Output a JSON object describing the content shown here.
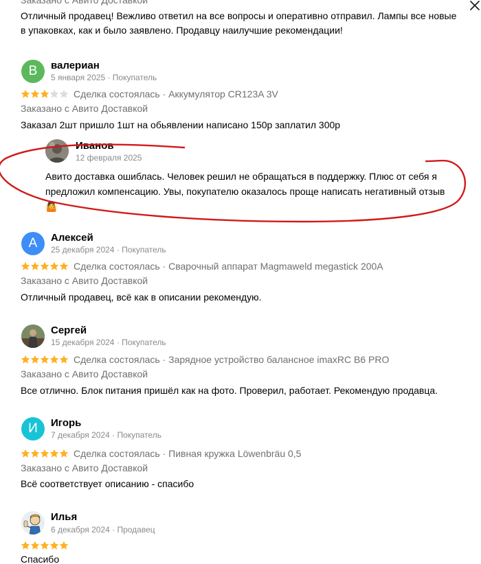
{
  "top": {
    "ordered_label": "Заказано с Авито Доставкой",
    "text_line1": "Отличный продавец! Вежливо ответил на все вопросы и оперативно отправил. Лампы все новые",
    "text_line2": "в упаковках, как и было заявлено. Продавцу наилучшие рекомендации!"
  },
  "reviews": [
    {
      "name": "валериан",
      "initial": "В",
      "avatar_color": "#5cb85c",
      "date_role": "5 января 2025 · Покупатель",
      "rating": 3,
      "deal": "Сделка состоялась · Аккумулятор CR123A 3V",
      "ordered_label": "Заказано с Авито Доставкой",
      "text": "Заказал 2шт пришло 1шт на обьявлении написано 150р заплатил 300р",
      "reply": {
        "name": "Иванов",
        "date": "12 февраля 2025",
        "text_line1": "Авито доставка ошиблась. Человек решил не обращаться в поддержку. Плюс от себя я",
        "text_line2": "предложил компенсацию. Увы, покупателю оказалось проще написать негативный отзыв",
        "emoji": "🤷"
      }
    },
    {
      "name": "Алексей",
      "initial": "А",
      "avatar_color": "#3d8ef7",
      "date_role": "25 декабря 2024 · Покупатель",
      "rating": 5,
      "deal": "Сделка состоялась · Сварочный аппарат Magmaweld megastick 200A",
      "ordered_label": "Заказано с Авито Доставкой",
      "text": "Отличный продавец, всё как в описании рекомендую."
    },
    {
      "name": "Сергей",
      "date_role": "15 декабря 2024 · Покупатель",
      "rating": 5,
      "deal": "Сделка состоялась · Зарядное устройство балансное imaxRC B6 PRO",
      "ordered_label": "Заказано с Авито Доставкой",
      "text": "Все отлично. Блок питания пришёл как на фото. Проверил, работает. Рекомендую продавца."
    },
    {
      "name": "Игорь",
      "initial": "И",
      "avatar_color": "#19c3d6",
      "date_role": "7 декабря 2024 · Покупатель",
      "rating": 5,
      "deal": "Сделка состоялась · Пивная кружка Löwenbräu 0,5",
      "ordered_label": "Заказано с Авито Доставкой",
      "text": "Всё соответствует описанию - спасибо"
    },
    {
      "name": "Илья",
      "date_role": "6 декабря 2024 · Продавец",
      "rating": 5,
      "text": "Спасибо"
    }
  ],
  "colors": {
    "star_filled": "#ffb021",
    "star_empty": "#dcdcdc",
    "annotation": "#d11a1a"
  }
}
